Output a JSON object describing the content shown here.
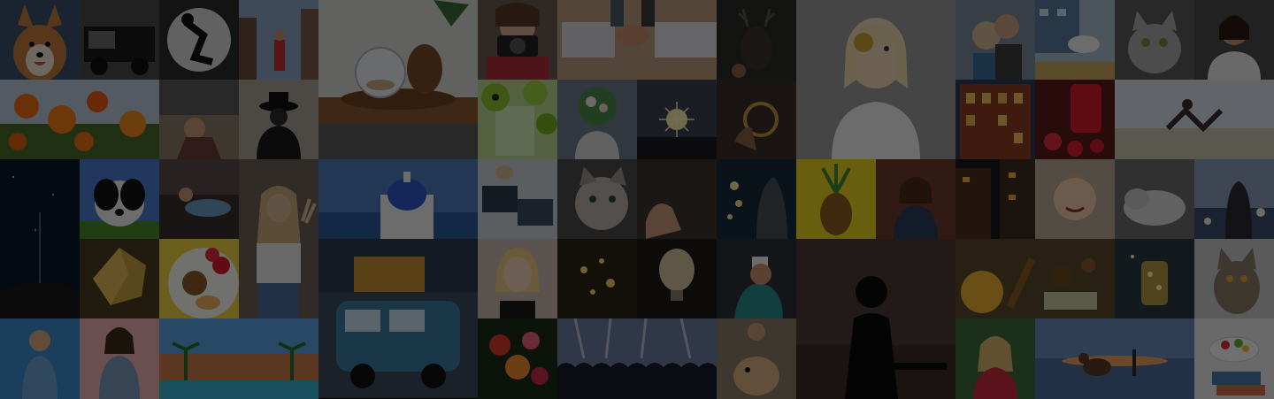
{
  "overlay": {
    "dim": 0.55,
    "color": "#000000"
  },
  "photos": [
    {
      "subject": "corgi-dog",
      "tone": "#8a5a32"
    },
    {
      "subject": "old-pickup-truck",
      "tone": "#2a2a2a"
    },
    {
      "subject": "skateboarder-bw",
      "tone": "#3a3a3a"
    },
    {
      "subject": "city-street-crowd",
      "tone": "#6a4a3a"
    },
    {
      "subject": "terrarium-pinecone-table",
      "tone": "#5b3e24"
    },
    {
      "subject": "woman-camera",
      "tone": "#7a4a44"
    },
    {
      "subject": "laptops-handshake",
      "tone": "#3d3a36"
    },
    {
      "subject": "dark-deer",
      "tone": "#1a1a1a"
    },
    {
      "subject": "blonde-woman-coin",
      "tone": "#6f6f6f"
    },
    {
      "subject": "couple-portrait",
      "tone": "#4a4a55"
    },
    {
      "subject": "seagull-building",
      "tone": "#5a6a7a"
    },
    {
      "subject": "grey-cat",
      "tone": "#4a4a4a"
    },
    {
      "subject": "woman-phone",
      "tone": "#3a3a3a"
    },
    {
      "subject": "orange-poppies",
      "tone": "#a14a14"
    },
    {
      "subject": "couple-balcony",
      "tone": "#4a3a3a"
    },
    {
      "subject": "man-hat-silhouette",
      "tone": "#3a3a3a"
    },
    {
      "subject": "kiwi-drink",
      "tone": "#4a6a2a"
    },
    {
      "subject": "flowers-face",
      "tone": "#3a4a3a"
    },
    {
      "subject": "sparkler",
      "tone": "#2a2a3a"
    },
    {
      "subject": "hand-compass",
      "tone": "#2a2020"
    },
    {
      "subject": "brick-building-night",
      "tone": "#5a2a1a"
    },
    {
      "subject": "strawberries-jar",
      "tone": "#8a1a1a"
    },
    {
      "subject": "woman-beach-pose",
      "tone": "#8a8a8a"
    },
    {
      "subject": "night-sky-horizon",
      "tone": "#0c1420"
    },
    {
      "subject": "border-collie",
      "tone": "#2a3a5a"
    },
    {
      "subject": "woman-peace-sign",
      "tone": "#4a4036"
    },
    {
      "subject": "santorini-dome",
      "tone": "#2c4a7a"
    },
    {
      "subject": "office-desk-laptops",
      "tone": "#3a4650"
    },
    {
      "subject": "cat-portrait",
      "tone": "#2a2a2a"
    },
    {
      "subject": "light-bulb-hand",
      "tone": "#2a2420"
    },
    {
      "subject": "woman-bokeh-lights",
      "tone": "#1a2230"
    },
    {
      "subject": "pineapple-yellow",
      "tone": "#c8b21c"
    },
    {
      "subject": "woman-brick-wall",
      "tone": "#4a3026"
    },
    {
      "subject": "city-night-street",
      "tone": "#3a2a1a"
    },
    {
      "subject": "smiling-girl",
      "tone": "#8a6650"
    },
    {
      "subject": "dog-sleeping",
      "tone": "#4a4a4a"
    },
    {
      "subject": "woman-lights-sunset",
      "tone": "#2a3448"
    },
    {
      "subject": "crystal-rock",
      "tone": "#6a5a2a"
    },
    {
      "subject": "fruit-plate",
      "tone": "#d8a050"
    },
    {
      "subject": "blonde-woman-portrait",
      "tone": "#7a5a50"
    },
    {
      "subject": "glowing-lights-hand",
      "tone": "#2a2418"
    },
    {
      "subject": "bulb-night",
      "tone": "#221c18"
    },
    {
      "subject": "man-coffee-cup",
      "tone": "#2a3038"
    },
    {
      "subject": "campervan-sunset",
      "tone": "#2a3a4a"
    },
    {
      "subject": "man-silhouette-sunset",
      "tone": "#3a2a26"
    },
    {
      "subject": "honey-food-table",
      "tone": "#6a4a1a"
    },
    {
      "subject": "fireflies-jar",
      "tone": "#2a2c26"
    },
    {
      "subject": "tabby-cat",
      "tone": "#6a6a6a"
    },
    {
      "subject": "woman-blue-water",
      "tone": "#2a5a8a"
    },
    {
      "subject": "woman-denim",
      "tone": "#6a7a8a"
    },
    {
      "subject": "resort-pool-palms",
      "tone": "#3a7aaa"
    },
    {
      "subject": "flowers-bouquet",
      "tone": "#7a2a2a"
    },
    {
      "subject": "concert-crowd",
      "tone": "#4a5a7a"
    },
    {
      "subject": "hiker-with-dog",
      "tone": "#6a5a4a"
    },
    {
      "subject": "woman-flowers-red",
      "tone": "#8a3a3a"
    },
    {
      "subject": "dog-beach-sunset",
      "tone": "#3a4a6a"
    },
    {
      "subject": "salad-bowl-books",
      "tone": "#c8c8c8"
    }
  ]
}
